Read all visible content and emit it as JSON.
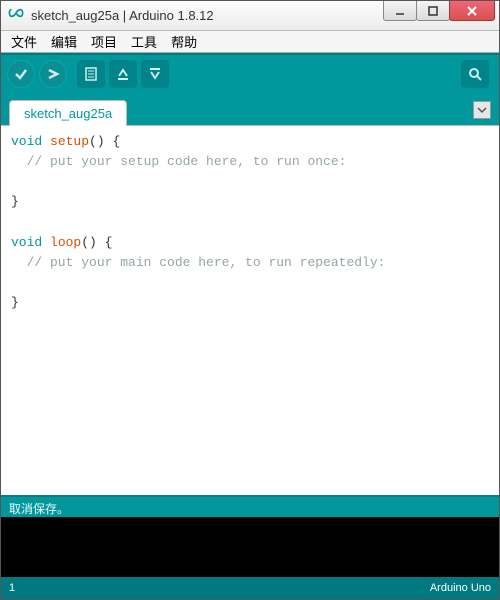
{
  "window": {
    "title": "sketch_aug25a | Arduino 1.8.12"
  },
  "menu": {
    "file": "文件",
    "edit": "编辑",
    "project": "项目",
    "tools": "工具",
    "help": "帮助"
  },
  "tabs": {
    "active": "sketch_aug25a"
  },
  "code": {
    "kw_void1": "void",
    "fn_setup": "setup",
    "setup_rest": "() {",
    "setup_comment": "  // put your setup code here, to run once:",
    "close1": "}",
    "kw_void2": "void",
    "fn_loop": "loop",
    "loop_rest": "() {",
    "loop_comment": "  // put your main code here, to run repeatedly:",
    "close2": "}"
  },
  "status_message": "取消保存。",
  "statusbar": {
    "line": "1",
    "board": "Arduino Uno"
  },
  "colors": {
    "teal": "#00979d",
    "teal_dark": "#007a80"
  }
}
